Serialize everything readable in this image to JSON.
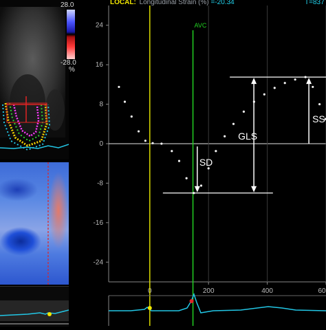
{
  "header": {
    "local_label": "LOCAL:",
    "metric_label": "Longitudinal Strain (%)",
    "metric_value": "=-20.34",
    "time_label": "T=837"
  },
  "color_scale": {
    "max_label": "28.0",
    "min_label": "-28.0",
    "unit_label": "%"
  },
  "event_marker": {
    "label": "AVC",
    "x_ms": 147,
    "color": "#21d121"
  },
  "reference_line": {
    "x_ms": 0,
    "color": "#d9d900"
  },
  "annotations": {
    "sd_label": "SD",
    "gls_label": "GLS",
    "ss_label": "SS"
  },
  "chart_data": {
    "type": "scatter",
    "title": "",
    "xlabel": "",
    "ylabel": "",
    "xlim": [
      -140,
      600
    ],
    "ylim": [
      -28,
      28
    ],
    "x_ticks": [
      0,
      200,
      400,
      "60"
    ],
    "y_ticks": [
      24,
      16,
      8,
      0,
      -8,
      -16,
      -24
    ],
    "series": [
      {
        "points": [
          {
            "x": -105,
            "y": 11.5
          },
          {
            "x": -85,
            "y": 8.5
          },
          {
            "x": -62,
            "y": 5.5
          },
          {
            "x": -38,
            "y": 2.5
          },
          {
            "x": -15,
            "y": 0.6
          },
          {
            "x": 10,
            "y": 0.1
          },
          {
            "x": 40,
            "y": 0.0
          },
          {
            "x": 75,
            "y": -1.5
          },
          {
            "x": 100,
            "y": -3.5
          },
          {
            "x": 125,
            "y": -7.0
          },
          {
            "x": 150,
            "y": -10.0
          },
          {
            "x": 175,
            "y": -8.5
          },
          {
            "x": 200,
            "y": -5.0
          },
          {
            "x": 225,
            "y": -1.5
          },
          {
            "x": 255,
            "y": 1.5
          },
          {
            "x": 285,
            "y": 4.0
          },
          {
            "x": 320,
            "y": 6.5
          },
          {
            "x": 355,
            "y": 8.5
          },
          {
            "x": 390,
            "y": 10.0
          },
          {
            "x": 425,
            "y": 11.3
          },
          {
            "x": 460,
            "y": 12.3
          },
          {
            "x": 495,
            "y": 13.0
          },
          {
            "x": 530,
            "y": 13.5
          },
          {
            "x": 555,
            "y": 11.5
          },
          {
            "x": 578,
            "y": 8.0
          },
          {
            "x": 598,
            "y": 5.0
          }
        ]
      }
    ]
  }
}
